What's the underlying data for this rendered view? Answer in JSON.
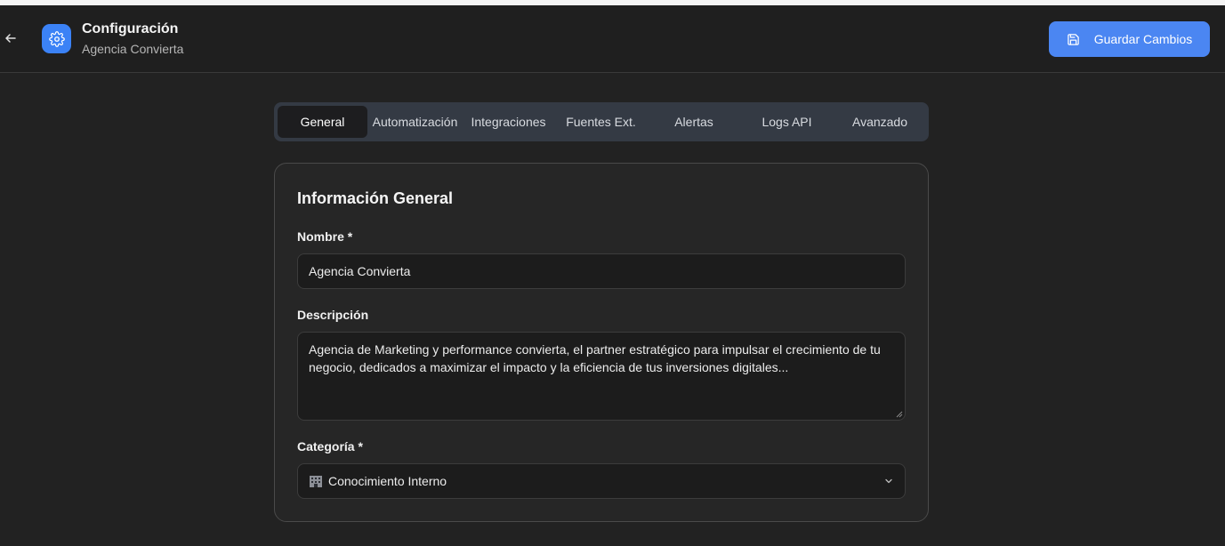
{
  "header": {
    "title": "Configuración",
    "subtitle": "Agencia Convierta",
    "save_label": "Guardar Cambios",
    "back_icon": "arrow-left-icon",
    "app_icon": "gear-icon",
    "save_icon": "save-icon",
    "accent_color": "#4b86f2"
  },
  "tabs": [
    {
      "label": "General",
      "active": true
    },
    {
      "label": "Automatización",
      "active": false
    },
    {
      "label": "Integraciones",
      "active": false
    },
    {
      "label": "Fuentes Ext.",
      "active": false
    },
    {
      "label": "Alertas",
      "active": false
    },
    {
      "label": "Logs API",
      "active": false
    },
    {
      "label": "Avanzado",
      "active": false
    }
  ],
  "form": {
    "section_title": "Información General",
    "name_label": "Nombre *",
    "name_value": "Agencia Convierta",
    "description_label": "Descripción",
    "description_value": "Agencia de Marketing y performance convierta, el partner estratégico para impulsar el crecimiento de tu negocio, dedicados a maximizar el impacto y la eficiencia de tus inversiones digitales...",
    "category_label": "Categoría *",
    "category_value": "Conocimiento Interno",
    "category_icon": "building-icon",
    "select_icon": "chevron-down-icon"
  }
}
